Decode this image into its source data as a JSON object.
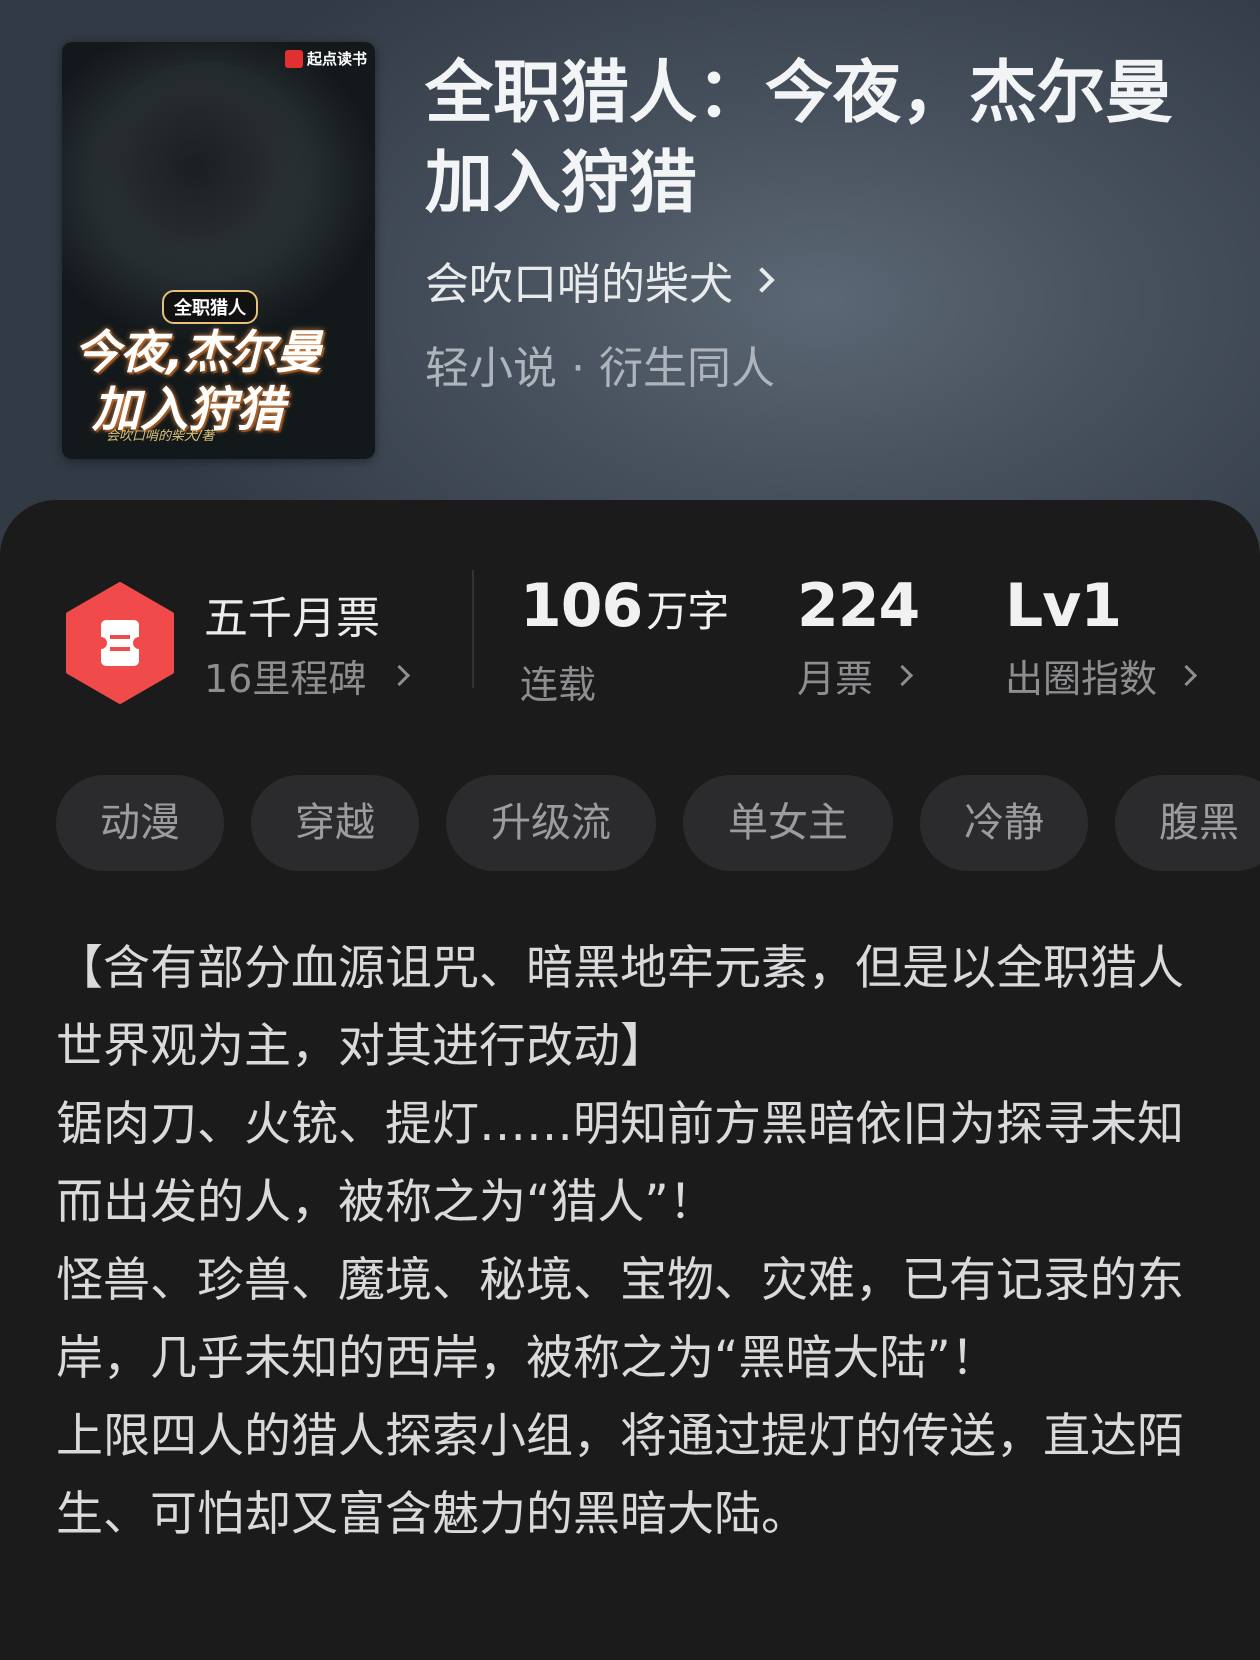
{
  "book": {
    "cover": {
      "brand": "起点读书",
      "series_label": "全职猎人",
      "title_line1": "今夜,杰尔曼",
      "title_line2": "加入狩猎",
      "byline": "会吹口哨的柴犬/著"
    },
    "title": "全职猎人：今夜，杰尔曼加入狩猎",
    "author": "会吹口哨的柴犬",
    "genre": "轻小说 · 衍生同人"
  },
  "stats": {
    "milestone": {
      "title": "五千月票",
      "subtitle": "16里程碑"
    },
    "word_count": {
      "value": "106",
      "unit": "万字",
      "label": "连载"
    },
    "monthly_tickets": {
      "value": "224",
      "label": "月票"
    },
    "popularity": {
      "value": "Lv1",
      "label": "出圈指数"
    }
  },
  "tags": [
    "动漫",
    "穿越",
    "升级流",
    "单女主",
    "冷静",
    "腹黑"
  ],
  "description": [
    "【含有部分血源诅咒、暗黑地牢元素，但是以全职猎人世界观为主，对其进行改动】",
    "锯肉刀、火铳、提灯……明知前方黑暗依旧为探寻未知而出发的人，被称之为“猎人”！",
    "怪兽、珍兽、魔境、秘境、宝物、灾难，已有记录的东岸，几乎未知的西岸，被称之为“黑暗大陆”！",
    "上限四人的猎人探索小组，将通过提灯的传送，直达陌生、可怕却又富含魅力的黑暗大陆。"
  ],
  "colors": {
    "badge_red": "#f04a4a",
    "sheet_bg": "#1b1b1c",
    "tag_bg": "#2b2b2d"
  }
}
